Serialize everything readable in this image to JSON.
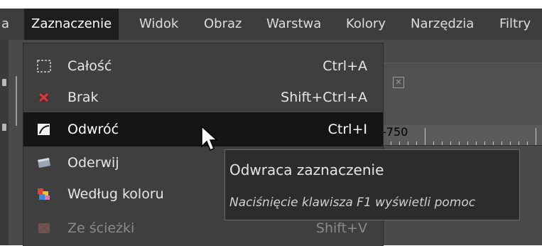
{
  "menubar": {
    "items": [
      {
        "label": "a"
      },
      {
        "label": "Zaznaczenie"
      },
      {
        "label": "Widok"
      },
      {
        "label": "Obraz"
      },
      {
        "label": "Warstwa"
      },
      {
        "label": "Kolory"
      },
      {
        "label": "Narzędzia"
      },
      {
        "label": "Filtry"
      }
    ],
    "active_index": 1
  },
  "menu": {
    "items": [
      {
        "label": "Całość",
        "shortcut": "Ctrl+A",
        "icon": "select-all-icon",
        "state": "normal"
      },
      {
        "label": "Brak",
        "shortcut": "Shift+Ctrl+A",
        "icon": "select-none-icon",
        "state": "normal"
      },
      {
        "label": "Odwróć",
        "shortcut": "Ctrl+I",
        "icon": "invert-selection-icon",
        "state": "highlighted"
      },
      {
        "label": "Oderwij",
        "shortcut": "",
        "icon": "float-selection-icon",
        "state": "normal"
      },
      {
        "label": "Według koloru",
        "shortcut": "",
        "icon": "select-by-color-icon",
        "state": "normal"
      },
      {
        "label": "Ze ścieżki",
        "shortcut": "Shift+V",
        "icon": "from-path-icon",
        "state": "disabled"
      }
    ]
  },
  "ruler": {
    "label": "-750"
  },
  "tooltip": {
    "title": "Odwraca zaznaczenie",
    "help": "Naciśnięcie klawisza F1 wyświetli pomoc"
  },
  "colors": {
    "menu_bg": "#3f3f3f",
    "highlight_bg": "#151515",
    "text": "#e6e6e6",
    "disabled_text": "#8a8a8a",
    "brak_icon": "#c83232"
  }
}
